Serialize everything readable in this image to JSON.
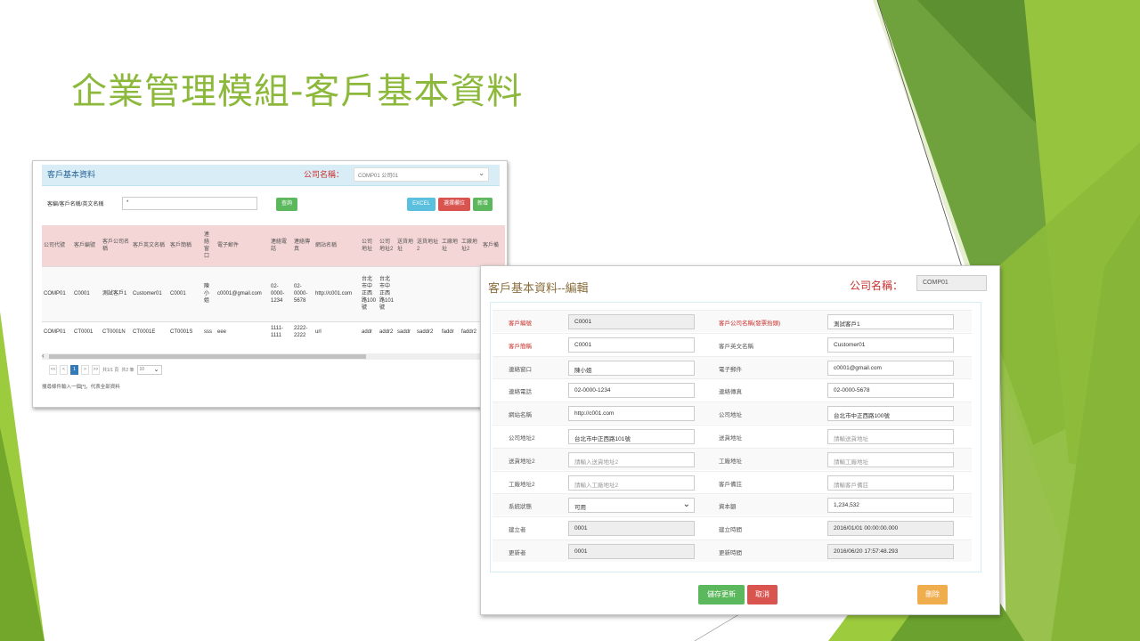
{
  "slide": {
    "title": "企業管理模組-客戶基本資料",
    "colors": {
      "title": "#8cb83b",
      "green_light": "#a4c93a",
      "green_mid": "#73a72c",
      "green_dark": "#4f7a22"
    }
  },
  "list_view": {
    "panel_title": "客戶基本資料",
    "company_label": "公司名稱：",
    "company_select": "COMP01 公司01",
    "search_label": "客編/客戶名稱/英文名稱",
    "search_value": "*",
    "buttons": {
      "query": "查詢",
      "excel": "EXCEL",
      "column_select": "選擇欄位",
      "add": "新增"
    },
    "columns": [
      "公司代號",
      "客戶編號",
      "客戶公司名稱",
      "客戶英文名稱",
      "客戶簡稱",
      "連絡窗口",
      "電子郵件",
      "連絡電話",
      "連絡傳真",
      "網站名稱",
      "公司地址",
      "公司地址2",
      "送貨地址",
      "送貨地址2",
      "工廠地址",
      "工廠地址2",
      "客戶備"
    ],
    "rows": [
      [
        "COMP01",
        "C0001",
        "測試客戶1",
        "Customer01",
        "C0001",
        "陳小姐",
        "c0001@gmail.com",
        "02-0000-1234",
        "02-0000-5678",
        "http://c001.com",
        "台北市中正西路100號",
        "台北市中正西路101號",
        "",
        "",
        "",
        "",
        ""
      ],
      [
        "COMP01",
        "CT0001",
        "CT0001N",
        "CT0001E",
        "CT0001S",
        "sss",
        "eee",
        "1111-1111",
        "2222-2222",
        "url",
        "addr",
        "addr2",
        "saddr",
        "saddr2",
        "faddr",
        "faddr2",
        ""
      ]
    ],
    "pager": {
      "first": "<<",
      "prev": "<",
      "current": "1",
      "next": ">",
      "last": ">>",
      "page_info": "共1/1 頁",
      "total": "共2 筆",
      "page_size": "10"
    },
    "hint": "搜尋條件輸入一個[*]，代表全部資料"
  },
  "edit_view": {
    "title": "客戶基本資料--編輯",
    "company_label": "公司名稱：",
    "company_value": "COMP01",
    "fields": [
      {
        "label": "客戶編號",
        "value": "C0001",
        "required": true,
        "readonly": true
      },
      {
        "label": "客戶公司名稱(發票抬頭)",
        "value": "測試客戶1",
        "required": true
      },
      {
        "label": "客戶簡稱",
        "value": "C0001",
        "required": true
      },
      {
        "label": "客戶英文名稱",
        "value": "Customer01"
      },
      {
        "label": "連絡窗口",
        "value": "陳小姐"
      },
      {
        "label": "電子郵件",
        "value": "c0001@gmail.com"
      },
      {
        "label": "連絡電話",
        "value": "02-0000-1234"
      },
      {
        "label": "連絡傳真",
        "value": "02-0000-5678"
      },
      {
        "label": "網站名稱",
        "value": "http://c001.com"
      },
      {
        "label": "公司地址",
        "value": "台北市中正西路100號"
      },
      {
        "label": "公司地址2",
        "value": "台北市中正西路101號"
      },
      {
        "label": "送貨地址",
        "placeholder": "請輸送貨地址"
      },
      {
        "label": "送貨地址2",
        "placeholder": "請輸入送貨地址2"
      },
      {
        "label": "工廠地址",
        "placeholder": "請輸工廠地址"
      },
      {
        "label": "工廠地址2",
        "placeholder": "請輸入工廠地址2"
      },
      {
        "label": "客戶備註",
        "placeholder": "請輸客戶備註"
      },
      {
        "label": "系統狀態",
        "value": "可用",
        "type": "select"
      },
      {
        "label": "資本額",
        "value": "1,234,532"
      },
      {
        "label": "建立者",
        "value": "0001",
        "readonly": true
      },
      {
        "label": "建立時間",
        "value": "2016/01/01 00:00:00.000",
        "readonly": true
      },
      {
        "label": "更新者",
        "value": "0001",
        "readonly": true
      },
      {
        "label": "更新時間",
        "value": "2016/06/20 17:57:48.293",
        "readonly": true
      }
    ],
    "buttons": {
      "save": "儲存更新",
      "cancel": "取消",
      "delete": "刪除"
    }
  }
}
